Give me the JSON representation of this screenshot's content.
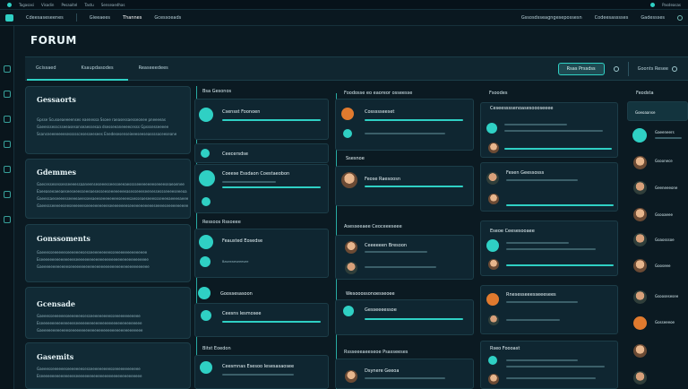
{
  "topbar": {
    "items": [
      "Tagasasi",
      "Visadin",
      "Pesaaitel",
      "Tastu",
      "Senseaedhas"
    ],
    "right": "Pasdeasas"
  },
  "nav": {
    "items": [
      "Cdeesaseseenes",
      "Gieeaees",
      "Thannes",
      "Gcessoeads"
    ],
    "right": [
      "Gssosdsseagngesepossesn",
      "Codeesasssses",
      "Gadessses"
    ]
  },
  "page": {
    "title": "FORUM"
  },
  "tabs": {
    "items": [
      "Gcissaed",
      "Ksaupdasodes",
      "Reaseeedees"
    ],
    "search": "Rsas Prssdss",
    "sort": "Goonts Resee"
  },
  "left": {
    "sections": [
      {
        "title": "Gessaorts",
        "lines": [
          "Gpsse Scusoeaeeeenses eaenessa Ssoee raeasessaesseonee pneeeeas",
          "Gaeesssesscsseeasesonseaessesaa dsesseeaneeeecesss Gpsssesseeeee",
          "Ssansneeeeeeesessssscesesseesees Enedesesenseieeeseeseassssoceeseane"
        ]
      },
      {
        "title": "Gdemmes",
        "lines": [
          "Gaecessesessesseeeessaaneenseseeesseesseeeaesssseeeeeeeeseeeeseaeoenee",
          "Eaeeaseeaeeaeseeseeesseeeaesesseeseeeeeeeeasesseeeseenessessseeeeseeeoa",
          "Gaeessaeseeeesseeeeaeesseeaeeseeeeeeeeseeeesaesseaeseeessseeeeaeeeeaeee",
          "Gaeessseeeeeseeseeeeeeseeeeeeeeeeseeeeeeeeseeeeeeeeeeeseeeeseeeeeeeeee"
        ]
      },
      {
        "title": "Gonssoments",
        "lines": [
          "Gaeeesseeeeeeseeeeeeesesseeeeeeeeesseeeeeeeeeeeeeee",
          "Eseeeeeeeeeeeeeeeseeeeeeeeeeeeeeeeeeeeeeeeeeeeeeeee",
          "Gaeeeeeeeeeeeeseeeeeeeeeeeeeeeeeeeeeeeeeeeeeeeeeeee"
        ]
      },
      {
        "title": "Gcensade",
        "lines": [
          "Gaeeesseeeeeeseeeeeeesesseeeeeeeeesseeeeeeeeeeee",
          "Eseeeeeeeeeeeeeeeseeeeeeeeeeeeeeeeeeeeeeeeeeeeee",
          "Gaeeeeeeeeeeeeseeeeeeeeeeeeeeeeeeeeeeeeeeeeeeeee"
        ]
      },
      {
        "title": "Gasemits",
        "lines": [
          "Gaeeesseeeeeeseeeeeeesesseeeeeeeeesseeeeeeeeeeee",
          "Eseeeeeeeeeeeeeeeseeeeeeeeeeeeeeeeeeeeeeeeeeeeee"
        ]
      }
    ]
  },
  "col2": {
    "head": "Bsa Gesonos",
    "cards": [
      {
        "title": "Csensst Foonoen",
        "sub": ""
      },
      {
        "title": "Ceecersdse",
        "sub": ""
      },
      {
        "title": "Coeese Essdaon Coestaeobon",
        "sub": ""
      }
    ],
    "head2": "Ressoos Rssoeee",
    "cards2": [
      {
        "title": "Feausted Eosedse",
        "sub": "Baseeaeseeesee"
      },
      {
        "title": "Goossesasoon",
        "sub": ""
      },
      {
        "title": "Ceesns Iesmosee",
        "sub": ""
      }
    ],
    "head3": "Bitst Eoedon",
    "cards3": [
      {
        "title": "Ceesmnas Esesoo Iesesasaosee",
        "sub": ""
      }
    ]
  },
  "col3": {
    "head": "Foodosse eo eaoreor osseesse",
    "cards": [
      {
        "title": "Cossssseeset",
        "sub": ""
      },
      {
        "title": "Ssesnoe",
        "sub": ""
      },
      {
        "title": "Feose Raesoosn",
        "sub": ""
      }
    ],
    "head2": "Asesseeaee Ceoceeeseee",
    "cards2": [
      {
        "title": "Ceeeeeen Bresoon",
        "sub": ""
      },
      {
        "title": "Wesooossonoesseoee",
        "sub": ""
      },
      {
        "title": "Gesseeeessoe",
        "sub": ""
      }
    ],
    "head3": "Rssseeeaeeseoe Psasseeses",
    "cards3": [
      {
        "title": "Dsynere Geeoa",
        "sub": ""
      }
    ]
  },
  "col4": {
    "head": "Fsoodes",
    "cards": [
      {
        "title": "Ceseessssenoasesoooseeee",
        "sub": ""
      },
      {
        "title": "Fesen Geessosss",
        "sub": ""
      },
      {
        "title": "Eseoe Ceesesooaee",
        "sub": ""
      },
      {
        "title": "Rnesesseeesseeesees",
        "sub": ""
      },
      {
        "title": "Reaoeaaseeees",
        "sub": ""
      },
      {
        "title": "Rseo Foooast",
        "sub": ""
      }
    ]
  },
  "col5": {
    "head": "Feodsta",
    "items": [
      "Goeoaanse",
      "Gaeeneers",
      "Gsoonece",
      "Geeneeeone",
      "Gsooaeee",
      "Goaosssoe",
      "Gooseee",
      "Gsoosesesee",
      "Gosseeeoe"
    ]
  }
}
